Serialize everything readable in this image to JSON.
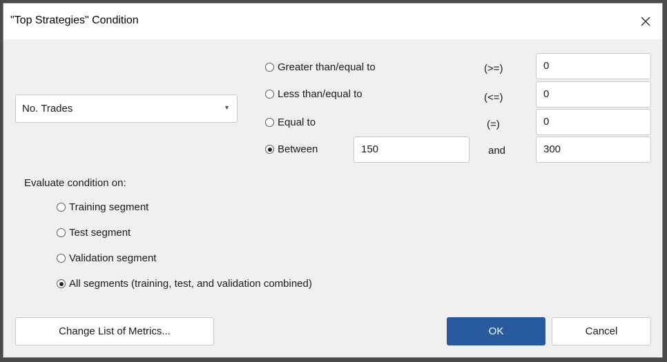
{
  "window": {
    "title": "\"Top Strategies\" Condition"
  },
  "metric_select": {
    "value": "No. Trades"
  },
  "comparison": {
    "options": [
      {
        "label": "Greater than/equal to",
        "symbol": "(>=)",
        "value": "0",
        "checked": false
      },
      {
        "label": "Less than/equal to",
        "symbol": "(<=)",
        "value": "0",
        "checked": false
      },
      {
        "label": "Equal to",
        "symbol": "(=)",
        "value": "0",
        "checked": false
      },
      {
        "label": "Between",
        "value_low": "150",
        "and_label": "and",
        "value_high": "300",
        "checked": true
      }
    ]
  },
  "evaluate": {
    "label": "Evaluate condition on:",
    "options": [
      {
        "label": "Training segment",
        "checked": false
      },
      {
        "label": "Test segment",
        "checked": false
      },
      {
        "label": "Validation segment",
        "checked": false
      },
      {
        "label": "All segments (training, test, and validation combined)",
        "checked": true
      }
    ]
  },
  "buttons": {
    "change_metrics": "Change List of Metrics...",
    "ok": "OK",
    "cancel": "Cancel"
  },
  "colors": {
    "primary": "#2a5a9e",
    "dialog_bg": "#f0f0f0"
  }
}
